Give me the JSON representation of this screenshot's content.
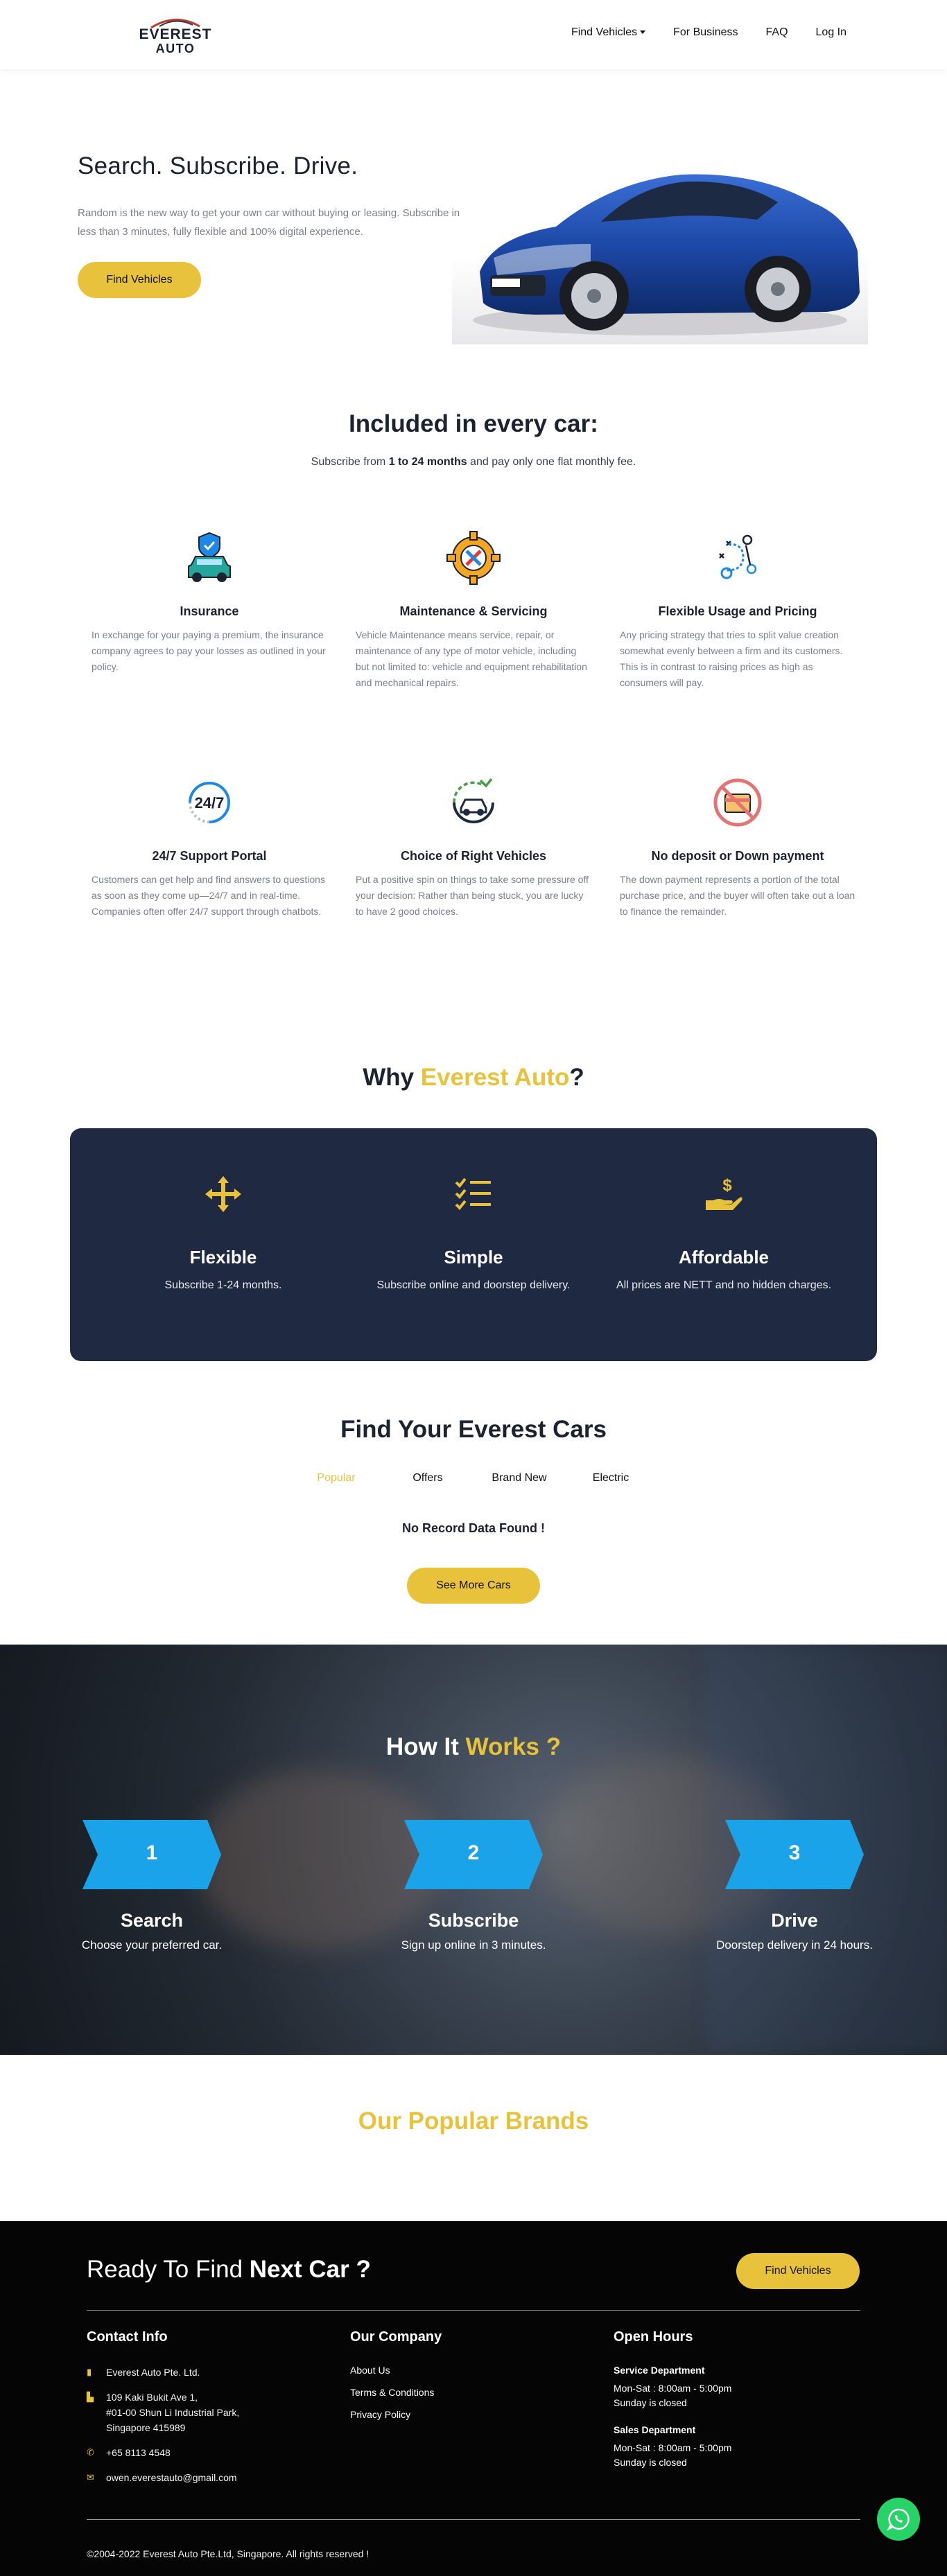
{
  "nav": {
    "logo_line1": "EVEREST",
    "logo_line2": "AUTO",
    "items": [
      "Find Vehicles",
      "For Business",
      "FAQ",
      "Log In"
    ]
  },
  "hero": {
    "title": "Search. Subscribe. Drive.",
    "text": "Random is the new way to get your own car without buying or leasing. Subscribe in less than 3 minutes, fully flexible and 100% digital experience.",
    "button": "Find Vehicles"
  },
  "included": {
    "title": "Included in every car:",
    "sub_prefix": "Subscribe from ",
    "sub_bold": "1 to 24 months",
    "sub_suffix": " and pay only one flat monthly fee.",
    "features": [
      {
        "icon": "insurance-icon",
        "title": "Insurance",
        "text": "In exchange for your paying a premium, the insurance company agrees to pay your losses as outlined in your policy."
      },
      {
        "icon": "maintenance-icon",
        "title": "Maintenance & Servicing",
        "text": "Vehicle Maintenance means service, repair, or maintenance of any type of motor vehicle, including but not limited to: vehicle and equipment rehabilitation and mechanical repairs."
      },
      {
        "icon": "strategy-icon",
        "title": "Flexible Usage and Pricing",
        "text": "Any pricing strategy that tries to split value creation somewhat evenly between a firm and its customers. This is in contrast to raising prices as high as consumers will pay."
      },
      {
        "icon": "support-24-7-icon",
        "title": "24/7 Support Portal",
        "text": "Customers can get help and find answers to questions as soon as they come up—24/7 and in real-time. Companies often offer 24/7 support through chatbots."
      },
      {
        "icon": "vehicle-choice-icon",
        "title": "Choice of Right Vehicles",
        "text": "Put a positive spin on things to take some pressure off your decision: Rather than being stuck, you are lucky to have 2 good choices."
      },
      {
        "icon": "no-deposit-icon",
        "title": "No deposit or Down payment",
        "text": "The down payment represents a portion of the total purchase price, and the buyer will often take out a loan to finance the remainder."
      }
    ]
  },
  "why": {
    "title_prefix": "Why ",
    "title_accent": "Everest Auto",
    "title_suffix": "?",
    "cols": [
      {
        "icon": "arrows-move-icon",
        "title": "Flexible",
        "text": "Subscribe 1-24 months."
      },
      {
        "icon": "checklist-icon",
        "title": "Simple",
        "text": "Subscribe online and doorstep delivery."
      },
      {
        "icon": "hand-dollar-icon",
        "title": "Affordable",
        "text": "All prices are NETT and no hidden charges."
      }
    ]
  },
  "find": {
    "title": "Find Your Everest Cars",
    "tabs": [
      "Popular",
      "Offers",
      "Brand New",
      "Electric"
    ],
    "empty": "No Record Data Found !",
    "button": "See More Cars"
  },
  "how": {
    "title_prefix": "How It ",
    "title_accent": "Works ?",
    "steps": [
      {
        "num": "1",
        "title": "Search",
        "text": "Choose your preferred car."
      },
      {
        "num": "2",
        "title": "Subscribe",
        "text": "Sign up online in 3 minutes."
      },
      {
        "num": "3",
        "title": "Drive",
        "text": "Doorstep delivery in 24 hours."
      }
    ]
  },
  "brands": {
    "title": "Our Popular Brands"
  },
  "footer": {
    "ready_prefix": "Ready To Find ",
    "ready_bold": "Next Car ?",
    "button": "Find Vehicles",
    "contact": {
      "title": "Contact Info",
      "company": "Everest Auto Pte. Ltd.",
      "address_1": "109 Kaki Bukit Ave 1,",
      "address_2": "#01-00 Shun Li Industrial Park,",
      "address_3": "Singapore 415989",
      "phone": "+65 8113 4548",
      "email": "owen.everestauto@gmail.com"
    },
    "company": {
      "title": "Our Company",
      "links": [
        "About Us",
        "Terms & Conditions",
        "Privacy Policy"
      ]
    },
    "hours": {
      "title": "Open Hours",
      "service_title": "Service Department",
      "service_1": "Mon-Sat : 8:00am - 5:00pm",
      "service_2": "Sunday is closed",
      "sales_title": "Sales Department",
      "sales_1": "Mon-Sat : 8:00am - 5:00pm",
      "sales_2": "Sunday is closed"
    },
    "copyright": "©2004-2022 Everest Auto Pte.Ltd, Singapore. All rights reserved !"
  },
  "colors": {
    "accent": "#e9c23b",
    "navy": "#1f2942",
    "step_blue": "#1aa3e8",
    "whatsapp": "#27d366"
  }
}
